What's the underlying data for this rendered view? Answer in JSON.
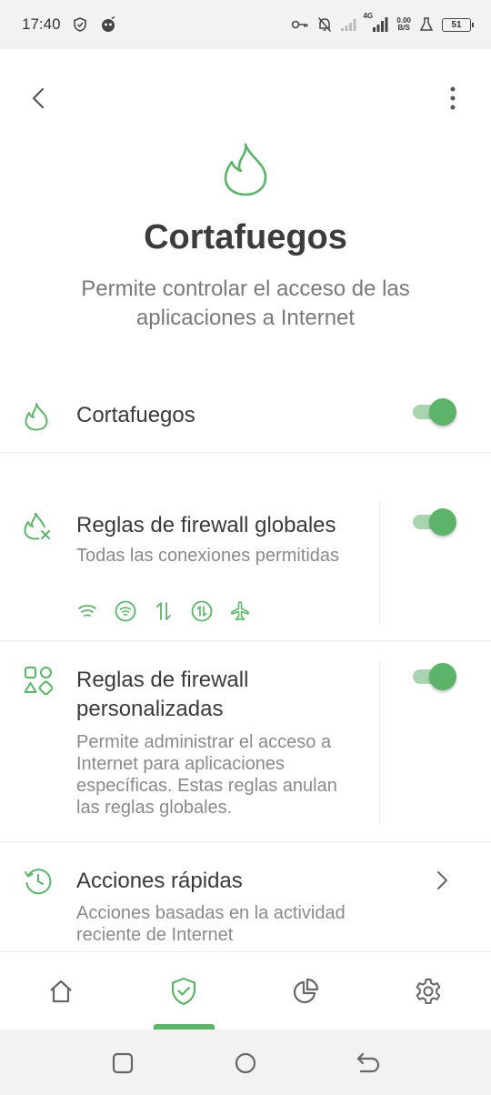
{
  "status_bar": {
    "time": "17:40",
    "network_type": "4G",
    "speed_value": "0.00",
    "speed_unit": "B/S",
    "battery": "51"
  },
  "header": {
    "title": "Cortafuegos",
    "subtitle": "Permite controlar el acceso de las aplicaciones a Internet"
  },
  "firewall_toggle": {
    "label": "Cortafuegos",
    "enabled": true
  },
  "global_rules": {
    "title": "Reglas de firewall globales",
    "description": "Todas las conexiones permitidas",
    "enabled": true,
    "connection_icons": [
      "wifi-icon",
      "wifi-circle-icon",
      "mobile-data-icon",
      "mobile-data-circle-icon",
      "airplane-icon"
    ]
  },
  "custom_rules": {
    "title": "Reglas de firewall personalizadas",
    "description": "Permite administrar el acceso a Internet para aplicaciones específicas. Estas reglas anulan las reglas globales.",
    "enabled": true
  },
  "quick_actions": {
    "title": "Acciones rápidas",
    "description": "Acciones basadas en la actividad reciente de Internet"
  },
  "bottom_nav": {
    "items": [
      "home-icon",
      "shield-check-icon",
      "pie-chart-icon",
      "gear-icon"
    ],
    "active_index": 1
  },
  "colors": {
    "accent": "#5db36a",
    "accent_light": "#a8d5b0",
    "text_primary": "#3a3a3a",
    "text_secondary": "#8a8a8a"
  }
}
